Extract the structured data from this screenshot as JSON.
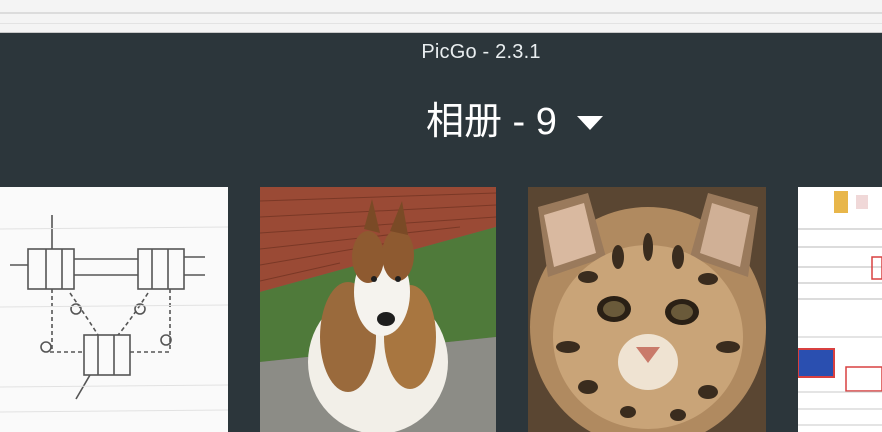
{
  "window": {
    "title": "PicGo - 2.3.1"
  },
  "album": {
    "title": "相册 - 9",
    "dropdown_icon": "triangle-down-icon"
  },
  "gallery": {
    "items": [
      {
        "name": "diagram-image"
      },
      {
        "name": "dog-image"
      },
      {
        "name": "cat-image"
      },
      {
        "name": "screenshot-image"
      }
    ]
  }
}
